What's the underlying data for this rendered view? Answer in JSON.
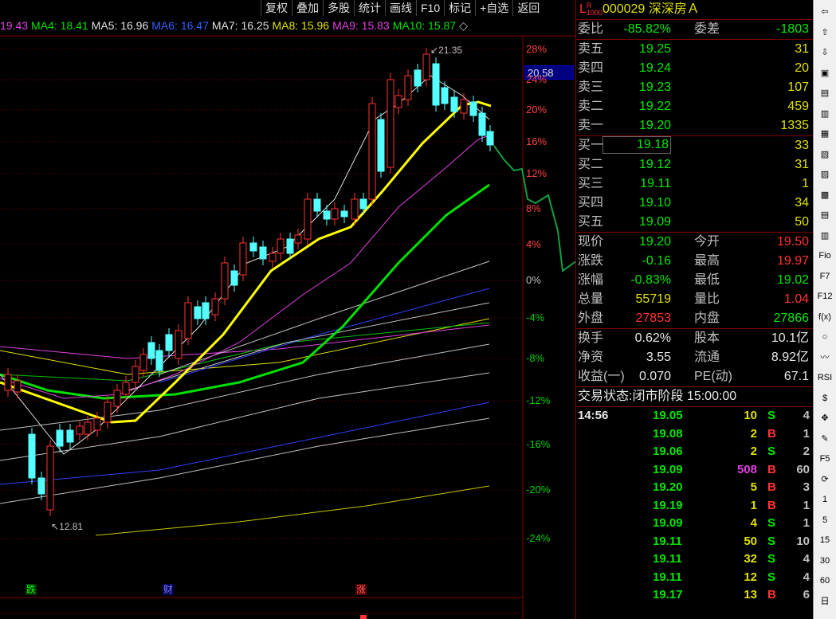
{
  "toolbar": [
    "复权",
    "叠加",
    "多股",
    "统计",
    "画线",
    "F10",
    "标记",
    "+自选",
    "返回"
  ],
  "ma_bar": [
    {
      "text": "19.43",
      "color": "#e040e0"
    },
    {
      "text": "MA4: 18.41",
      "color": "#00e000"
    },
    {
      "text": "MA5: 16.96",
      "color": "#e0e0e0"
    },
    {
      "text": "MA6: 16.47",
      "color": "#3060ff"
    },
    {
      "text": "MA7: 16.25",
      "color": "#e0e0e0"
    },
    {
      "text": "MA8: 15.96",
      "color": "#e0e000"
    },
    {
      "text": "MA9: 15.83",
      "color": "#e040e0"
    },
    {
      "text": "MA10: 15.87",
      "color": "#00e000"
    },
    {
      "text": "◇",
      "color": "#c0c0c0"
    }
  ],
  "price_tag": "20.58",
  "percent_axis": [
    "28%",
    "24%",
    "20%",
    "16%",
    "12%",
    "8%",
    "4%",
    "0%",
    "-4%",
    "-8%",
    "-12%",
    "-16%",
    "-20%",
    "-24%"
  ],
  "annotations": {
    "high": "21.35",
    "low": "12.81"
  },
  "events": [
    "跌",
    "财",
    "涨"
  ],
  "chart_data": {
    "type": "candlestick",
    "title": "",
    "ylim": [
      12.81,
      21.35
    ],
    "high": 21.35,
    "low": 12.81
  },
  "quote": {
    "code": "000029",
    "name": "深深房Ａ",
    "flag_l": "L",
    "flag_r": "R",
    "flag_num": "1000",
    "weibi_label": "委比",
    "weibi": "-85.82%",
    "weicha_label": "委差",
    "weicha": "-1803",
    "asks": [
      {
        "label": "卖五",
        "price": "19.25",
        "vol": "31"
      },
      {
        "label": "卖四",
        "price": "19.24",
        "vol": "20"
      },
      {
        "label": "卖三",
        "price": "19.23",
        "vol": "107"
      },
      {
        "label": "卖二",
        "price": "19.22",
        "vol": "459"
      },
      {
        "label": "卖一",
        "price": "19.20",
        "vol": "1335"
      }
    ],
    "bids": [
      {
        "label": "买一",
        "price": "19.18",
        "vol": "33"
      },
      {
        "label": "买二",
        "price": "19.12",
        "vol": "31"
      },
      {
        "label": "买三",
        "price": "19.11",
        "vol": "1"
      },
      {
        "label": "买四",
        "price": "19.10",
        "vol": "34"
      },
      {
        "label": "买五",
        "price": "19.09",
        "vol": "50"
      }
    ],
    "stats": [
      {
        "l1": "现价",
        "v1": "19.20",
        "c1": "green",
        "l2": "今开",
        "v2": "19.50",
        "c2": "red"
      },
      {
        "l1": "涨跌",
        "v1": "-0.16",
        "c1": "green",
        "l2": "最高",
        "v2": "19.97",
        "c2": "red"
      },
      {
        "l1": "涨幅",
        "v1": "-0.83%",
        "c1": "green",
        "l2": "最低",
        "v2": "19.02",
        "c2": "green"
      },
      {
        "l1": "总量",
        "v1": "55719",
        "c1": "yellow",
        "l2": "量比",
        "v2": "1.04",
        "c2": "red"
      },
      {
        "l1": "外盘",
        "v1": "27853",
        "c1": "red",
        "l2": "内盘",
        "v2": "27866",
        "c2": "green"
      }
    ],
    "fin": [
      {
        "l1": "换手",
        "v1": "0.62%",
        "l2": "股本",
        "v2": "10.1亿"
      },
      {
        "l1": "净资",
        "v1": "3.55",
        "l2": "流通",
        "v2": "8.92亿"
      },
      {
        "l1": "收益(一)",
        "v1": "0.070",
        "l2": "PE(动)",
        "v2": "67.1"
      }
    ],
    "status_label": "交易状态:",
    "status": "闭市阶段",
    "status_time": "15:00:00",
    "ticks": [
      {
        "t": "14:56",
        "p": "19.05",
        "pc": "green",
        "v": "10",
        "vc": "yellow",
        "f": "S",
        "fc": "green",
        "n": "4"
      },
      {
        "t": "",
        "p": "19.08",
        "pc": "green",
        "v": "2",
        "vc": "yellow",
        "f": "B",
        "fc": "red",
        "n": "1"
      },
      {
        "t": "",
        "p": "19.06",
        "pc": "green",
        "v": "2",
        "vc": "yellow",
        "f": "S",
        "fc": "green",
        "n": "2"
      },
      {
        "t": "",
        "p": "19.09",
        "pc": "green",
        "v": "508",
        "vc": "magenta",
        "f": "B",
        "fc": "red",
        "n": "60"
      },
      {
        "t": "",
        "p": "19.20",
        "pc": "green",
        "v": "5",
        "vc": "yellow",
        "f": "B",
        "fc": "red",
        "n": "3"
      },
      {
        "t": "",
        "p": "19.19",
        "pc": "green",
        "v": "1",
        "vc": "yellow",
        "f": "B",
        "fc": "red",
        "n": "1"
      },
      {
        "t": "",
        "p": "19.09",
        "pc": "green",
        "v": "4",
        "vc": "yellow",
        "f": "S",
        "fc": "green",
        "n": "1"
      },
      {
        "t": "",
        "p": "19.11",
        "pc": "green",
        "v": "50",
        "vc": "yellow",
        "f": "S",
        "fc": "green",
        "n": "10"
      },
      {
        "t": "",
        "p": "19.11",
        "pc": "green",
        "v": "32",
        "vc": "yellow",
        "f": "S",
        "fc": "green",
        "n": "4"
      },
      {
        "t": "",
        "p": "19.11",
        "pc": "green",
        "v": "12",
        "vc": "yellow",
        "f": "S",
        "fc": "green",
        "n": "4"
      },
      {
        "t": "",
        "p": "19.17",
        "pc": "green",
        "v": "13",
        "vc": "yellow",
        "f": "B",
        "fc": "red",
        "n": "6"
      }
    ]
  },
  "sidebar": [
    "⇦",
    "⇧",
    "⇩",
    "▣",
    "▤",
    "▥",
    "▦",
    "▧",
    "▨",
    "▩",
    "▤",
    "▥",
    "Fio",
    "F7",
    "F12",
    "f(x)",
    "○",
    "〰",
    "RSI",
    "$",
    "✥",
    "✎",
    "F5",
    "⟳",
    "1",
    "5",
    "15",
    "30",
    "60",
    "日"
  ]
}
